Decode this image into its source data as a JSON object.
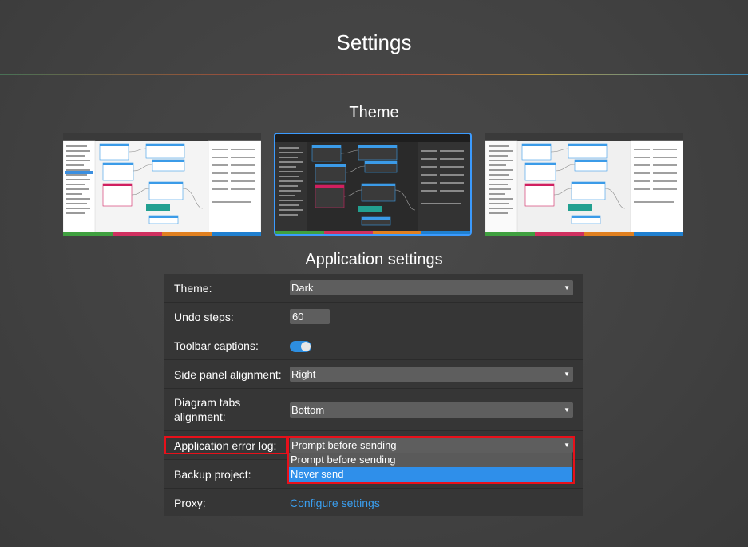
{
  "page": {
    "title": "Settings"
  },
  "theme_section": {
    "heading": "Theme",
    "options": [
      {
        "name": "light",
        "selected": false
      },
      {
        "name": "dark",
        "selected": true
      },
      {
        "name": "light-alt",
        "selected": false
      }
    ],
    "accent": "#3b9bff"
  },
  "app_settings": {
    "heading": "Application settings",
    "theme": {
      "label": "Theme:",
      "value": "Dark"
    },
    "undo_steps": {
      "label": "Undo steps:",
      "value": "60"
    },
    "toolbar_captions": {
      "label": "Toolbar captions:",
      "enabled": true
    },
    "side_panel_alignment": {
      "label": "Side panel alignment:",
      "value": "Right"
    },
    "diagram_tabs_alignment": {
      "label_line1": "Diagram tabs",
      "label_line2": "alignment:",
      "value": "Bottom"
    },
    "error_log": {
      "label": "Application error log:",
      "value": "Prompt before sending",
      "options": [
        "Prompt before sending",
        "Never send"
      ],
      "highlighted_option": "Never send"
    },
    "backup_project": {
      "label": "Backup project:"
    },
    "proxy": {
      "label": "Proxy:",
      "link": "Configure settings"
    }
  },
  "colors": {
    "highlight": "#e8101a",
    "link": "#3a9ff0",
    "selection": "#2f8fea"
  }
}
